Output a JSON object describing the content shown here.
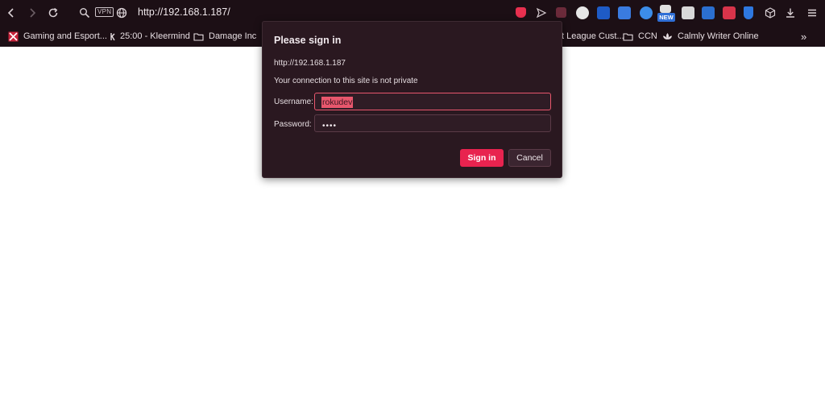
{
  "toolbar": {
    "back_icon": "chevron-left-icon",
    "forward_icon": "chevron-right-icon",
    "reload_icon": "reload-icon",
    "vpn_label": "VPN",
    "url": "http://192.168.1.187/",
    "extensions_new_badge": "NEW"
  },
  "bookmarks": {
    "items": [
      {
        "label": "Gaming and Esport..."
      },
      {
        "label": "25:00 - Kleermind"
      },
      {
        "label": "Damage Inc"
      },
      {
        "label": "t League Cust..."
      },
      {
        "label": "CCN"
      },
      {
        "label": "Calmly Writer Online"
      }
    ],
    "overflow_label": "»"
  },
  "dialog": {
    "title": "Please sign in",
    "origin": "http://192.168.1.187",
    "warning": "Your connection to this site is not private",
    "username_label": "Username:",
    "username_value": "rokudev",
    "password_label": "Password:",
    "password_mask": "••••",
    "sign_in_label": "Sign in",
    "cancel_label": "Cancel"
  },
  "colors": {
    "chrome_bg": "#1c0f15",
    "dialog_bg": "#2a1820",
    "accent": "#e8234f",
    "focus_border": "#e8576d"
  }
}
